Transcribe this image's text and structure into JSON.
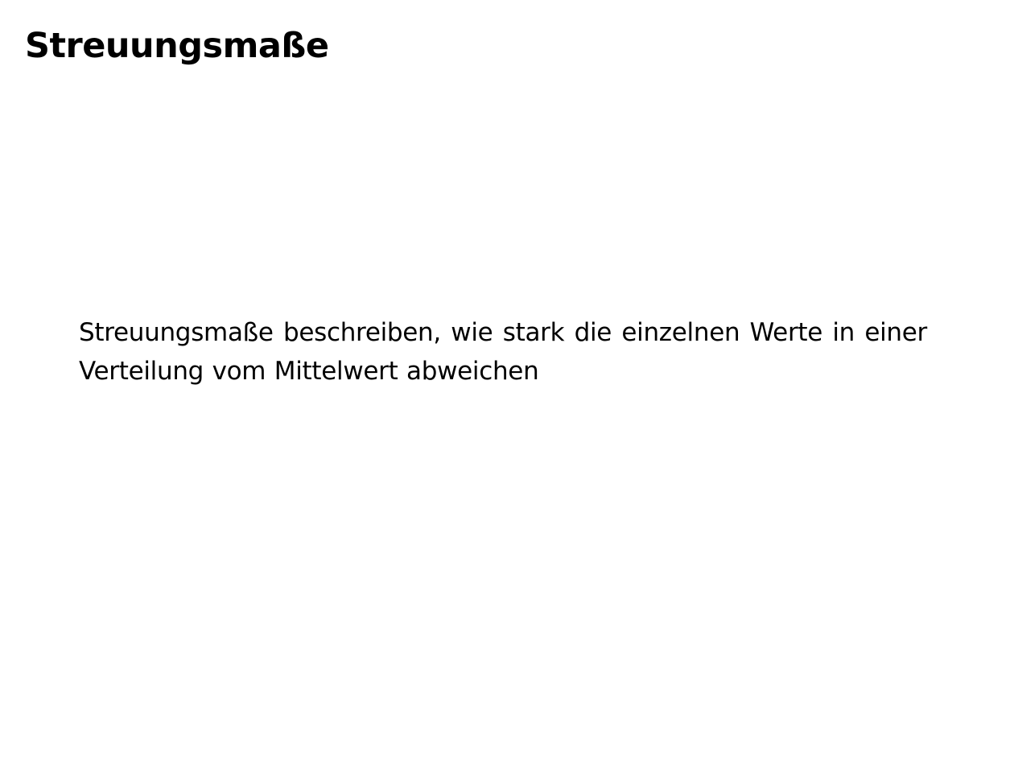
{
  "slide": {
    "title": "Streuungsmaße",
    "body": "Streuungsmaße beschreiben, wie stark die einzelnen Werte in einer Verteilung vom Mittelwert abweichen"
  }
}
